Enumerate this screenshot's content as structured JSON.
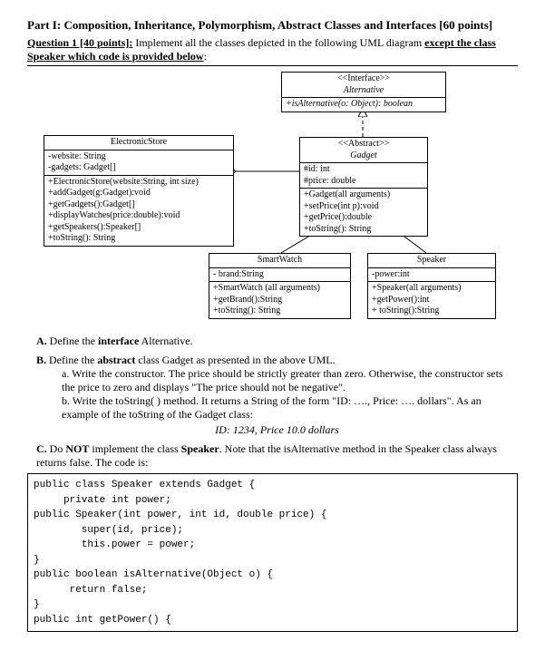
{
  "header": {
    "part_label": "Part I:",
    "part_title": "Composition, Inheritance, Polymorphism, Abstract Classes and Interfaces [60 points]",
    "q_label": "Question 1 [40 points]:",
    "q_text1": "Implement all the classes depicted in the following UML diagram ",
    "q_except": "except the class Speaker which code is provided below",
    "q_colon": ":"
  },
  "uml": {
    "interface": {
      "stereo": "<<Interface>>",
      "name": "Alternative",
      "op": "+isAlternative(o: Object): boolean"
    },
    "store": {
      "name": "ElectronicStore",
      "attr1": "-website: String",
      "attr2": "-gadgets: Gadget[]",
      "op1": "+ElectronicStore(website:String, int size)",
      "op2": "+addGadget(g:Gadget):void",
      "op3": "+getGadgets():Gadget[]",
      "op4": "+displayWatches(price:double):void",
      "op5": "+getSpeakers():Speaker[]",
      "op6": "+toString(): String"
    },
    "gadget": {
      "stereo": "<<Abstract>>",
      "name": "Gadget",
      "attr1": "#id: int",
      "attr2": "#price: double",
      "op1": "+Gadget(all arguments)",
      "op2": "+setPrice(int p):void",
      "op3": "+getPrice():double",
      "op4": "+toString(): String"
    },
    "smartwatch": {
      "name": "SmartWatch",
      "attr1": "- brand:String",
      "op1": "+SmartWatch (all arguments)",
      "op2": "+getBrand():String",
      "op3": "+toString(): String"
    },
    "speaker": {
      "name": "Speaker",
      "attr1": "-power:int",
      "op1": "+Speaker(all arguments)",
      "op2": "+getPower():int",
      "op3": "+ toString():String"
    }
  },
  "tasks": {
    "a_label": "A.",
    "a_text": "Define the interface Alternative.",
    "b_label": "B.",
    "b_text": "Define the abstract class Gadget as presented in the above UML.",
    "b_a_label": "a.",
    "b_a_text": "Write the constructor. The price should be strictly greater than zero. Otherwise, the constructor sets the price to zero and displays \"The price should not be negative\".",
    "b_b_label": "b.",
    "b_b_text": "Write the toString( ) method. It returns a String of the form \"ID: …., Price: …. dollars\". As an example of the toString of the Gadget class:",
    "b_b_example": "ID: 1234, Price 10.0 dollars",
    "c_label": "C.",
    "c_text": "Do NOT implement the class Speaker. Note that the isAlternative method in the Speaker class always returns false. The code is:"
  },
  "code": {
    "l1": "public class Speaker extends Gadget {",
    "l2": "     private int power;",
    "l3": "public Speaker(int power, int id, double price) {",
    "l4": "        super(id, price);",
    "l5": "        this.power = power;",
    "l6": "}",
    "l7": "public boolean isAlternative(Object o) {",
    "l8": "      return false;",
    "l9": "}",
    "l10": "public int getPower() {"
  }
}
